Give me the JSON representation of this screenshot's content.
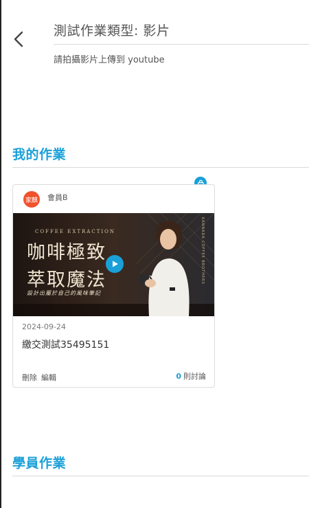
{
  "header": {
    "title": "測試作業類型: 影片",
    "subtitle": "請拍攝影片上傳到 youtube"
  },
  "sections": {
    "my_homework": "我的作業",
    "student_homework": "學員作業"
  },
  "submission": {
    "avatar_text": "家麒",
    "member_name": "會員B",
    "date": "2024-09-24",
    "title": "繳交測試35495151",
    "delete_label": "刪除",
    "edit_label": "編輯",
    "discussion_count": "0",
    "discussion_label": "則討論",
    "thumbnail": {
      "caption": "COFFEE EXTRACTION",
      "line1": "咖啡極致",
      "line2": "萃取魔法",
      "sub": "設計出屬於自己的風味筆記",
      "brand": "KANNADA COFFEE BROTHERS"
    }
  },
  "colors": {
    "accent": "#1aa0d8",
    "avatar": "#f0522d"
  }
}
